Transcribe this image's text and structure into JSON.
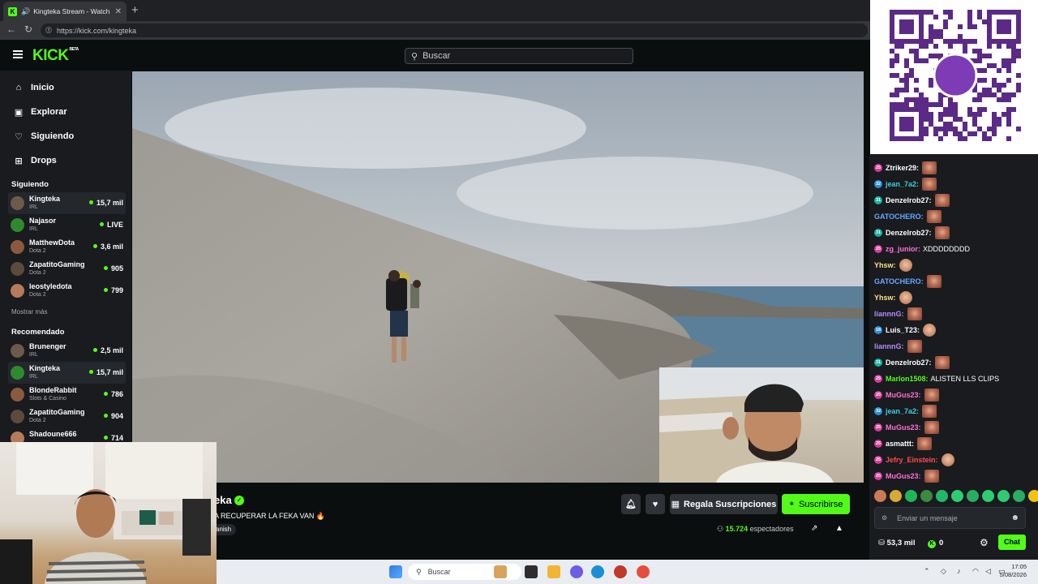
{
  "browser": {
    "tab_title": "Kingteka Stream - Watch Live",
    "tab_favicon": "K",
    "url": "https://kick.com/kingteka"
  },
  "header": {
    "logo": "KICK",
    "logo_badge": "BETA",
    "search_placeholder": "Buscar"
  },
  "sidebar": {
    "nav": [
      {
        "label": "Inicio",
        "icon": "home-icon"
      },
      {
        "label": "Explorar",
        "icon": "compass-icon"
      },
      {
        "label": "Siguiendo",
        "icon": "heart-icon"
      },
      {
        "label": "Drops",
        "icon": "drops-icon"
      }
    ],
    "following_title": "Siguiendo",
    "following": [
      {
        "name": "Kingteka",
        "category": "IRL",
        "viewers": "15,7 mil"
      },
      {
        "name": "Najasor",
        "category": "IRL",
        "viewers": "LIVE"
      },
      {
        "name": "MatthewDota",
        "category": "Dota 2",
        "viewers": "3,6 mil"
      },
      {
        "name": "ZapatitoGaming",
        "category": "Dota 2",
        "viewers": "905"
      },
      {
        "name": "leostyledota",
        "category": "Dota 2",
        "viewers": "799"
      }
    ],
    "show_more": "Mostrar más",
    "recommended_title": "Recomendado",
    "recommended": [
      {
        "name": "Brunenger",
        "category": "IRL",
        "viewers": "2,5 mil"
      },
      {
        "name": "Kingteka",
        "category": "IRL",
        "viewers": "15,7 mil"
      },
      {
        "name": "BlondeRabbit",
        "category": "Slots & Casino",
        "viewers": "786"
      },
      {
        "name": "ZapatitoGaming",
        "category": "Dota 2",
        "viewers": "904"
      },
      {
        "name": "Shadoune666",
        "category": "",
        "viewers": "714"
      }
    ]
  },
  "stream": {
    "name_fragment": "eka",
    "title_fragment": "A RECUPERAR LA FEKA VAN 🔥",
    "language_fragment": "anish",
    "gift_label": "Regala Suscripciones",
    "subscribe_label": "Suscribirse",
    "viewers_count": "15.724",
    "viewers_label": "espectadores"
  },
  "chat": {
    "messages": [
      {
        "user": "Ztriker29:",
        "color": "#ffffff",
        "badge": "pink",
        "badge_text": "25",
        "text": "",
        "emote": "e1"
      },
      {
        "user": "jean_7a2:",
        "color": "#3ecfd6",
        "badge": "blue",
        "badge_text": "32",
        "text": "",
        "emote": "e1"
      },
      {
        "user": "Denzelrob27:",
        "color": "#ffffff",
        "badge": "teal",
        "badge_text": "31",
        "text": "",
        "emote": "e1"
      },
      {
        "user": "GATOCHERO:",
        "color": "#6aa7ff",
        "badge": "",
        "badge_text": "",
        "text": "",
        "emote": "e1"
      },
      {
        "user": "Denzelrob27:",
        "color": "#ffffff",
        "badge": "teal",
        "badge_text": "31",
        "text": "",
        "emote": "e1"
      },
      {
        "user": "zg_junior:",
        "color": "#ff6fd8",
        "badge": "pink",
        "badge_text": "25",
        "text": "XDDDDDDDD",
        "emote": ""
      },
      {
        "user": "Yhsw:",
        "color": "#ffe08a",
        "badge": "",
        "badge_text": "",
        "text": "",
        "emote": "e2"
      },
      {
        "user": "GATOCHERO:",
        "color": "#6aa7ff",
        "badge": "",
        "badge_text": "",
        "text": "",
        "emote": "e1"
      },
      {
        "user": "Yhsw:",
        "color": "#ffe08a",
        "badge": "",
        "badge_text": "",
        "text": "",
        "emote": "e2"
      },
      {
        "user": "liannnG:",
        "color": "#b58cff",
        "badge": "",
        "badge_text": "",
        "text": "",
        "emote": "e1"
      },
      {
        "user": "Luis_T23:",
        "color": "#ffffff",
        "badge": "blue",
        "badge_text": "18",
        "text": "",
        "emote": "e2"
      },
      {
        "user": "liannnG:",
        "color": "#b58cff",
        "badge": "",
        "badge_text": "",
        "text": "",
        "emote": "e1"
      },
      {
        "user": "Denzelrob27:",
        "color": "#ffffff",
        "badge": "teal",
        "badge_text": "31",
        "text": "",
        "emote": "e1"
      },
      {
        "user": "Marlon1508:",
        "color": "#53fc18",
        "badge": "pink",
        "badge_text": "25",
        "text": "ALISTEN LLS CLIPS",
        "emote": ""
      },
      {
        "user": "MuGus23:",
        "color": "#ff6fd8",
        "badge": "pink",
        "badge_text": "25",
        "text": "",
        "emote": "e1"
      },
      {
        "user": "jean_7a2:",
        "color": "#3ecfd6",
        "badge": "blue",
        "badge_text": "32",
        "text": "",
        "emote": "e1"
      },
      {
        "user": "MuGus23:",
        "color": "#ff6fd8",
        "badge": "pink",
        "badge_text": "25",
        "text": "",
        "emote": "e1"
      },
      {
        "user": "asmattt:",
        "color": "#ffffff",
        "badge": "pink",
        "badge_text": "25",
        "text": "",
        "emote": "e1"
      },
      {
        "user": "Jefry_Einstein:",
        "color": "#ff4d4d",
        "badge": "pink",
        "badge_text": "25",
        "text": "",
        "emote": "e2"
      },
      {
        "user": "MuGus23:",
        "color": "#ff6fd8",
        "badge": "pink",
        "badge_text": "25",
        "text": "",
        "emote": "e1"
      }
    ],
    "input_placeholder": "Enviar un mensaje",
    "points": "53,3 mil",
    "coins": "0",
    "chat_button": "Chat"
  },
  "taskbar": {
    "search_placeholder": "Buscar",
    "time": "17:05",
    "date": "5/08/2026"
  },
  "colors": {
    "accent": "#53fc18",
    "bg": "#0b0e0f",
    "panel": "#191b1f"
  }
}
